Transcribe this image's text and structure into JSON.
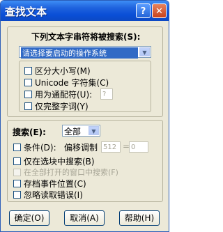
{
  "window": {
    "title": "查找文本",
    "help_glyph": "?",
    "close_glyph": "✕"
  },
  "find_text": {
    "label": "下列文本字串符将被搜索(S):",
    "value": "请选择要启动的操作系统",
    "drop_glyph": "▼"
  },
  "options": {
    "match_case": "区分大小写(M)",
    "unicode": "Unicode 字符集(C)",
    "wildcard": "用为通配符(U):",
    "wildcard_value": "?",
    "whole_word": "仅完整字词(Y)"
  },
  "search": {
    "label": "搜索(E):",
    "direction": "全部",
    "condition": "条件(D):",
    "offset_label": "偏移调制",
    "offset_value": "512",
    "equals": "=",
    "offset_result": "0",
    "selection_only": "仅在选块中搜索(B)",
    "all_open_windows": "在全部打开的窗口中搜索(F)",
    "save_position": "存档事件位置(C)",
    "ignore_errors": "忽略读取错误(I)"
  },
  "buttons": {
    "ok": "确定(O)",
    "cancel": "取消(A)",
    "help": "帮助(H)"
  }
}
